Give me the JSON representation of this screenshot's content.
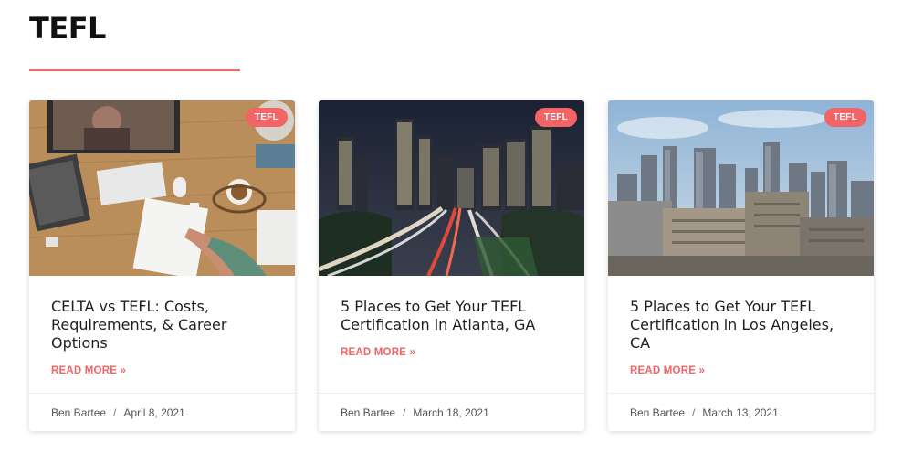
{
  "page": {
    "title": "TEFL"
  },
  "posts": [
    {
      "category": "TEFL",
      "title": "CELTA vs TEFL: Costs, Requirements, & Career Options",
      "read_more": "READ MORE »",
      "author": "Ben Bartee",
      "separator": "/",
      "date": "April 8, 2021"
    },
    {
      "category": "TEFL",
      "title": "5 Places to Get Your TEFL Certification in Atlanta, GA",
      "read_more": "READ MORE »",
      "author": "Ben Bartee",
      "separator": "/",
      "date": "March 18, 2021"
    },
    {
      "category": "TEFL",
      "title": "5 Places to Get Your TEFL Certification in Los Angeles, CA",
      "read_more": "READ MORE »",
      "author": "Ben Bartee",
      "separator": "/",
      "date": "March 13, 2021"
    }
  ],
  "colors": {
    "accent": "#f26465",
    "underline": "#ef6b6b"
  }
}
